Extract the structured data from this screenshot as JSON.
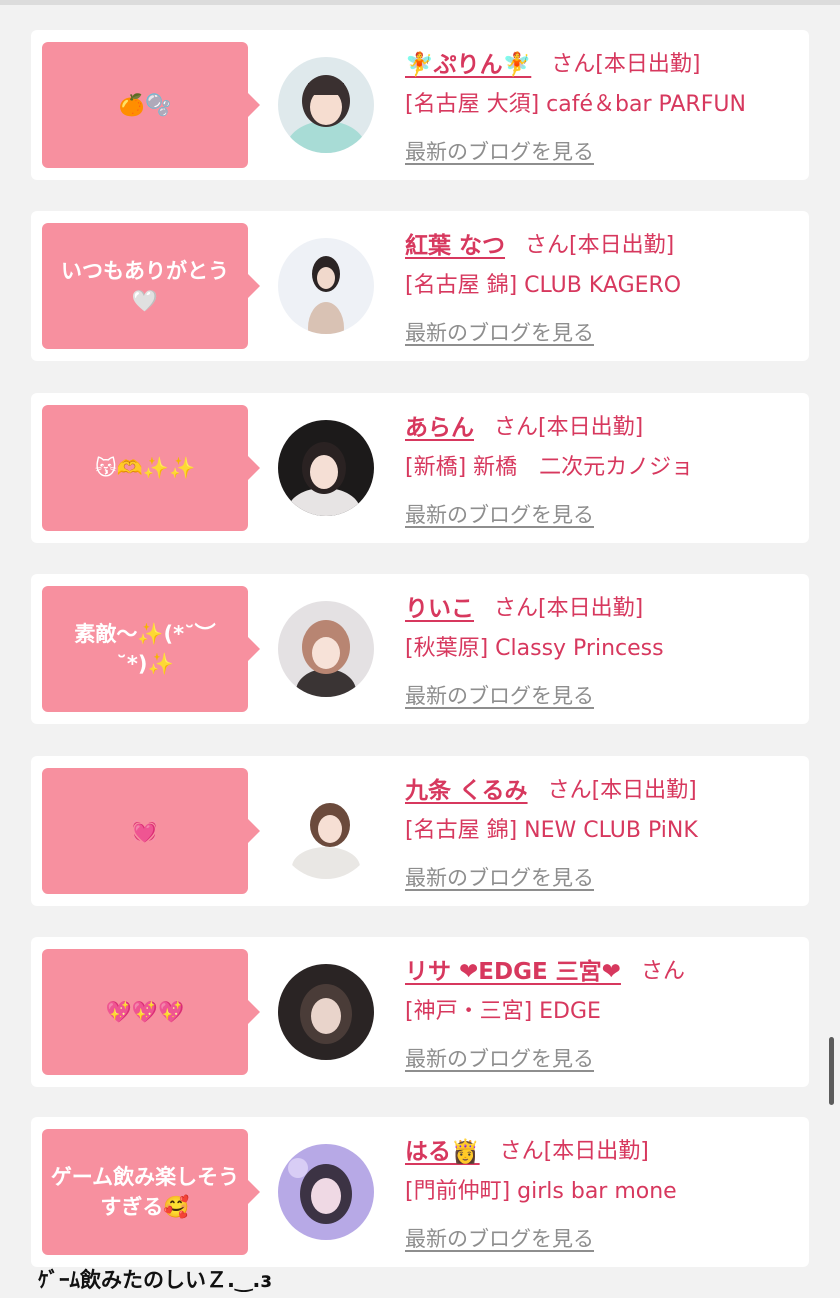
{
  "colors": {
    "accent": "#d7385e",
    "bubble": "#f7909f",
    "link_gray": "#8e8e8e",
    "background": "#f2f2f2"
  },
  "cards": [
    {
      "message": "🍊🫧",
      "name": "🧚ぷりん🧚",
      "suffix": "さん[本日出勤]",
      "store": "[名古屋 大須] café＆bar PARFUN",
      "blog_link": "最新のブログを見る",
      "avatar_icon": "cast-photo"
    },
    {
      "message": "いつもありがとう🤍",
      "name": "紅葉 なつ",
      "suffix": "さん[本日出勤]",
      "store": "[名古屋 錦] CLUB KAGERO",
      "blog_link": "最新のブログを見る",
      "avatar_icon": "cast-photo"
    },
    {
      "message": "😽🫶✨✨",
      "name": "あらん",
      "suffix": "さん[本日出勤]",
      "store": "[新橋] 新橋　二次元カノジョ",
      "blog_link": "最新のブログを見る",
      "avatar_icon": "cast-photo"
    },
    {
      "message": "素敵〜✨(*˘︶˘*)✨",
      "name": "りいこ",
      "suffix": "さん[本日出勤]",
      "store": "[秋葉原] Classy Princess",
      "blog_link": "最新のブログを見る",
      "avatar_icon": "cast-photo"
    },
    {
      "message": "💓",
      "name": "九条 くるみ",
      "suffix": "さん[本日出勤]",
      "store": "[名古屋 錦] NEW CLUB PiNK",
      "blog_link": "最新のブログを見る",
      "avatar_icon": "cast-photo"
    },
    {
      "message": "💖💖💖",
      "name": "リサ ❤EDGE 三宮❤",
      "suffix": "さん",
      "store": "[神戸・三宮] EDGE",
      "blog_link": "最新のブログを見る",
      "avatar_icon": "cast-photo"
    },
    {
      "message": "ゲーム飲み楽しそうすぎる🥰",
      "name": "はる👸",
      "suffix": "さん[本日出勤]",
      "store": "[門前仲町] girls bar mone",
      "blog_link": "最新のブログを見る",
      "avatar_icon": "cast-photo"
    }
  ],
  "caption": "ｹﾞｰﾑ飲みたのしいＺ.‿.ɜ"
}
